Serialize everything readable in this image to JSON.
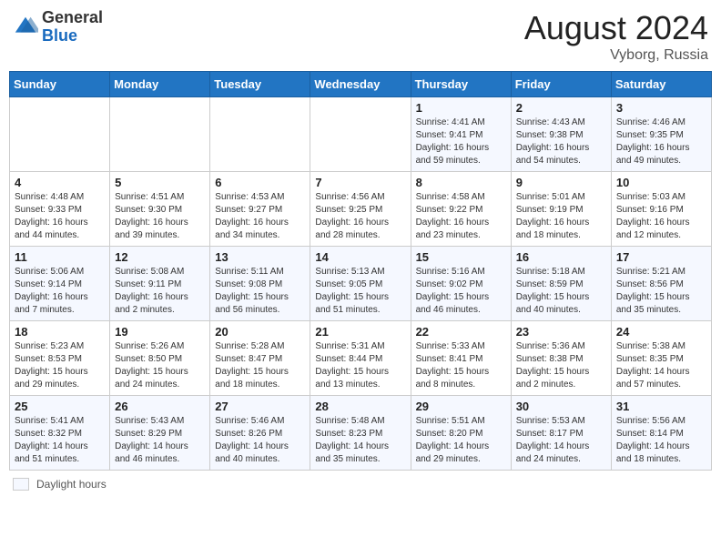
{
  "header": {
    "logo_general": "General",
    "logo_blue": "Blue",
    "month": "August 2024",
    "location": "Vyborg, Russia"
  },
  "legend": {
    "label": "Daylight hours"
  },
  "days_of_week": [
    "Sunday",
    "Monday",
    "Tuesday",
    "Wednesday",
    "Thursday",
    "Friday",
    "Saturday"
  ],
  "weeks": [
    [
      {
        "day": "",
        "info": ""
      },
      {
        "day": "",
        "info": ""
      },
      {
        "day": "",
        "info": ""
      },
      {
        "day": "",
        "info": ""
      },
      {
        "day": "1",
        "info": "Sunrise: 4:41 AM\nSunset: 9:41 PM\nDaylight: 16 hours and 59 minutes."
      },
      {
        "day": "2",
        "info": "Sunrise: 4:43 AM\nSunset: 9:38 PM\nDaylight: 16 hours and 54 minutes."
      },
      {
        "day": "3",
        "info": "Sunrise: 4:46 AM\nSunset: 9:35 PM\nDaylight: 16 hours and 49 minutes."
      }
    ],
    [
      {
        "day": "4",
        "info": "Sunrise: 4:48 AM\nSunset: 9:33 PM\nDaylight: 16 hours and 44 minutes."
      },
      {
        "day": "5",
        "info": "Sunrise: 4:51 AM\nSunset: 9:30 PM\nDaylight: 16 hours and 39 minutes."
      },
      {
        "day": "6",
        "info": "Sunrise: 4:53 AM\nSunset: 9:27 PM\nDaylight: 16 hours and 34 minutes."
      },
      {
        "day": "7",
        "info": "Sunrise: 4:56 AM\nSunset: 9:25 PM\nDaylight: 16 hours and 28 minutes."
      },
      {
        "day": "8",
        "info": "Sunrise: 4:58 AM\nSunset: 9:22 PM\nDaylight: 16 hours and 23 minutes."
      },
      {
        "day": "9",
        "info": "Sunrise: 5:01 AM\nSunset: 9:19 PM\nDaylight: 16 hours and 18 minutes."
      },
      {
        "day": "10",
        "info": "Sunrise: 5:03 AM\nSunset: 9:16 PM\nDaylight: 16 hours and 12 minutes."
      }
    ],
    [
      {
        "day": "11",
        "info": "Sunrise: 5:06 AM\nSunset: 9:14 PM\nDaylight: 16 hours and 7 minutes."
      },
      {
        "day": "12",
        "info": "Sunrise: 5:08 AM\nSunset: 9:11 PM\nDaylight: 16 hours and 2 minutes."
      },
      {
        "day": "13",
        "info": "Sunrise: 5:11 AM\nSunset: 9:08 PM\nDaylight: 15 hours and 56 minutes."
      },
      {
        "day": "14",
        "info": "Sunrise: 5:13 AM\nSunset: 9:05 PM\nDaylight: 15 hours and 51 minutes."
      },
      {
        "day": "15",
        "info": "Sunrise: 5:16 AM\nSunset: 9:02 PM\nDaylight: 15 hours and 46 minutes."
      },
      {
        "day": "16",
        "info": "Sunrise: 5:18 AM\nSunset: 8:59 PM\nDaylight: 15 hours and 40 minutes."
      },
      {
        "day": "17",
        "info": "Sunrise: 5:21 AM\nSunset: 8:56 PM\nDaylight: 15 hours and 35 minutes."
      }
    ],
    [
      {
        "day": "18",
        "info": "Sunrise: 5:23 AM\nSunset: 8:53 PM\nDaylight: 15 hours and 29 minutes."
      },
      {
        "day": "19",
        "info": "Sunrise: 5:26 AM\nSunset: 8:50 PM\nDaylight: 15 hours and 24 minutes."
      },
      {
        "day": "20",
        "info": "Sunrise: 5:28 AM\nSunset: 8:47 PM\nDaylight: 15 hours and 18 minutes."
      },
      {
        "day": "21",
        "info": "Sunrise: 5:31 AM\nSunset: 8:44 PM\nDaylight: 15 hours and 13 minutes."
      },
      {
        "day": "22",
        "info": "Sunrise: 5:33 AM\nSunset: 8:41 PM\nDaylight: 15 hours and 8 minutes."
      },
      {
        "day": "23",
        "info": "Sunrise: 5:36 AM\nSunset: 8:38 PM\nDaylight: 15 hours and 2 minutes."
      },
      {
        "day": "24",
        "info": "Sunrise: 5:38 AM\nSunset: 8:35 PM\nDaylight: 14 hours and 57 minutes."
      }
    ],
    [
      {
        "day": "25",
        "info": "Sunrise: 5:41 AM\nSunset: 8:32 PM\nDaylight: 14 hours and 51 minutes."
      },
      {
        "day": "26",
        "info": "Sunrise: 5:43 AM\nSunset: 8:29 PM\nDaylight: 14 hours and 46 minutes."
      },
      {
        "day": "27",
        "info": "Sunrise: 5:46 AM\nSunset: 8:26 PM\nDaylight: 14 hours and 40 minutes."
      },
      {
        "day": "28",
        "info": "Sunrise: 5:48 AM\nSunset: 8:23 PM\nDaylight: 14 hours and 35 minutes."
      },
      {
        "day": "29",
        "info": "Sunrise: 5:51 AM\nSunset: 8:20 PM\nDaylight: 14 hours and 29 minutes."
      },
      {
        "day": "30",
        "info": "Sunrise: 5:53 AM\nSunset: 8:17 PM\nDaylight: 14 hours and 24 minutes."
      },
      {
        "day": "31",
        "info": "Sunrise: 5:56 AM\nSunset: 8:14 PM\nDaylight: 14 hours and 18 minutes."
      }
    ]
  ]
}
